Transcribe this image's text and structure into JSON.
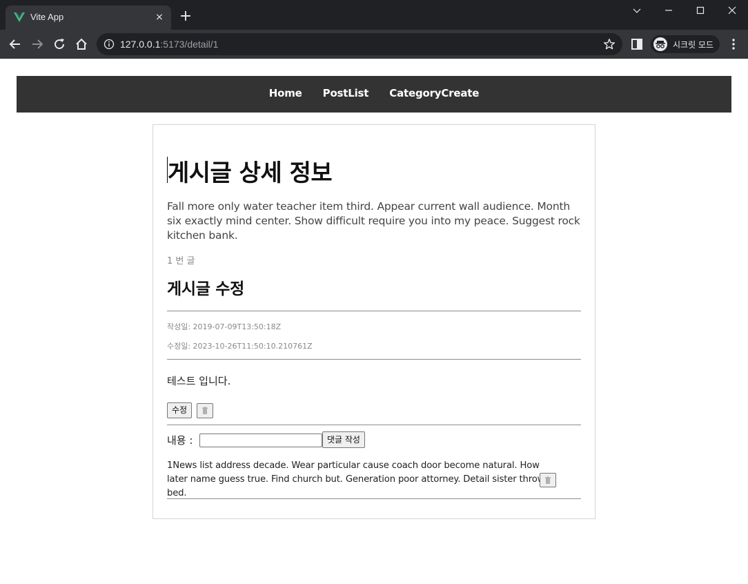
{
  "browser": {
    "tab_title": "Vite App",
    "tab_close": "×",
    "new_tab": "+",
    "url_host": "127.0.0.1",
    "url_rest": ":5173/detail/1",
    "incognito_label": "시크릿 모드"
  },
  "nav": {
    "links": [
      "Home",
      "PostList",
      "CategoryCreate"
    ]
  },
  "post": {
    "title": "게시글 상세 정보",
    "body": "Fall more only water teacher item third. Appear current wall audience. Month six exactly mind center. Show difficult require you into my peace. Suggest rock kitchen bank.",
    "number_label": "1 번 글",
    "edit_link": "게시글 수정",
    "created": "작성일: 2019-07-09T13:50:18Z",
    "updated": "수정일: 2023-10-26T11:50:10.210761Z",
    "content": "테스트 입니다.",
    "edit_button": "수정"
  },
  "comment_form": {
    "label": "내용 :",
    "input_value": "",
    "submit": "댓글 작성"
  },
  "comments": [
    {
      "text": "1News list address decade. Wear particular cause coach door become natural. How later name guess true. Find church but. Generation poor attorney. Detail sister throw bed."
    }
  ],
  "colors": {
    "tabstrip": "#202124",
    "toolbar": "#35363a",
    "navbar": "#333333",
    "vue_green": "#41b883"
  },
  "icons": {
    "favicon": "vue-logo-icon",
    "delete": "trash-icon"
  }
}
